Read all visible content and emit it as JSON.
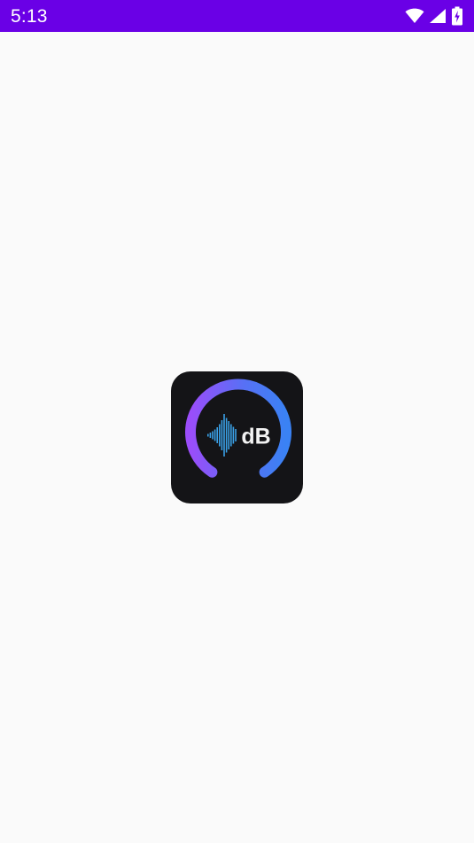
{
  "status_bar": {
    "time": "5:13",
    "background_color": "#6a00e6",
    "icons": [
      "wifi-icon",
      "cellular-signal-icon",
      "battery-charging-icon"
    ]
  },
  "splash": {
    "background_color": "#fafafa",
    "logo": {
      "icon": "sound-meter-logo-icon",
      "text": "dB",
      "gauge_gradient": [
        "#9b4dfa",
        "#5870f5",
        "#3a82f4"
      ],
      "waveform_color": "#3aa0e6",
      "tile_color": "#141417"
    }
  }
}
